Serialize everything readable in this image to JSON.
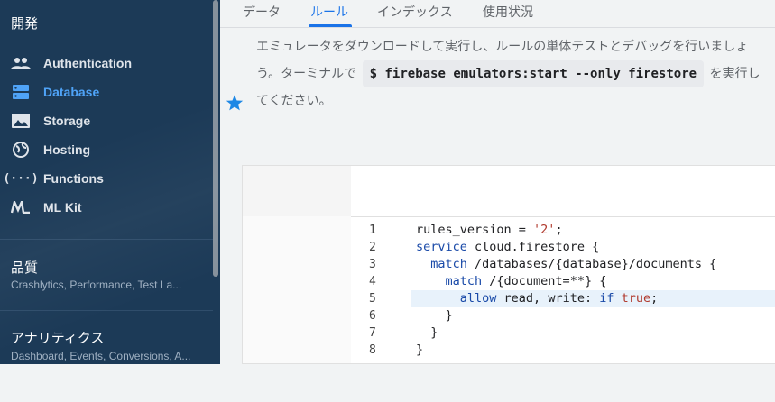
{
  "sidebar": {
    "section_dev": "開発",
    "items": [
      {
        "label": "Authentication",
        "icon": "people-icon"
      },
      {
        "label": "Database",
        "icon": "database-icon",
        "active": true
      },
      {
        "label": "Storage",
        "icon": "image-icon"
      },
      {
        "label": "Hosting",
        "icon": "globe-icon"
      },
      {
        "label": "Functions",
        "icon": "functions-icon"
      },
      {
        "label": "ML Kit",
        "icon": "mlkit-icon"
      }
    ],
    "section_quality": "品質",
    "section_quality_sub": "Crashlytics, Performance, Test La...",
    "section_analytics": "アナリティクス",
    "section_analytics_sub": "Dashboard, Events, Conversions, A..."
  },
  "tabs": [
    "データ",
    "ルール",
    "インデックス",
    "使用状況"
  ],
  "active_tab": "ルール",
  "notice": {
    "line1": "エミュレータをダウンロードして実行し、ルールの単体テストとデバッグを行いましょ",
    "line2_pre": "う。ターミナルで",
    "command": "$ firebase emulators:start --only firestore",
    "line2_post": "を実行し",
    "line3": "てください。"
  },
  "code": {
    "line_numbers": [
      "1",
      "2",
      "3",
      "4",
      "5",
      "6",
      "7",
      "8"
    ],
    "l1_a": "rules_version = ",
    "l1_str": "'2'",
    "l1_b": ";",
    "l2_kw": "service",
    "l2_b": " cloud.firestore {",
    "l3_ind": "  ",
    "l3_kw": "match",
    "l3_b": " /databases/{database}/documents {",
    "l4_ind": "    ",
    "l4_kw": "match",
    "l4_b": " /{document=**} {",
    "l5_ind": "      ",
    "l5_kw": "allow",
    "l5_b": " read, write: ",
    "l5_kw2": "if",
    "l5_sp": " ",
    "l5_val": "true",
    "l5_c": ";",
    "l6": "    }",
    "l7": "  }",
    "l8": "}"
  },
  "colors": {
    "accent": "#1a73e8",
    "sidebar_bg": "#1c3a57",
    "star": "#1e88e5"
  }
}
